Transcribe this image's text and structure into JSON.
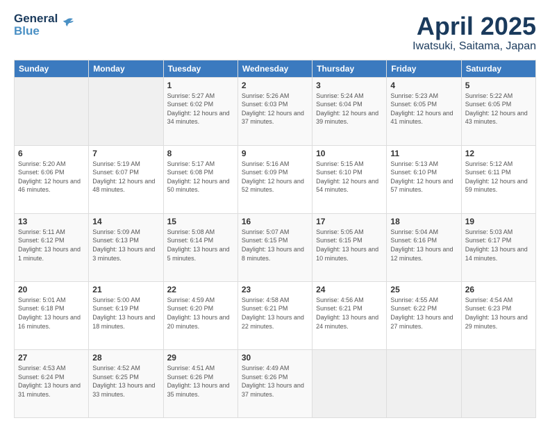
{
  "app": {
    "logo_line1": "General",
    "logo_line2": "Blue"
  },
  "header": {
    "title": "April 2025",
    "subtitle": "Iwatsuki, Saitama, Japan"
  },
  "weekdays": [
    "Sunday",
    "Monday",
    "Tuesday",
    "Wednesday",
    "Thursday",
    "Friday",
    "Saturday"
  ],
  "weeks": [
    [
      {
        "num": "",
        "info": ""
      },
      {
        "num": "",
        "info": ""
      },
      {
        "num": "1",
        "info": "Sunrise: 5:27 AM\nSunset: 6:02 PM\nDaylight: 12 hours and 34 minutes."
      },
      {
        "num": "2",
        "info": "Sunrise: 5:26 AM\nSunset: 6:03 PM\nDaylight: 12 hours and 37 minutes."
      },
      {
        "num": "3",
        "info": "Sunrise: 5:24 AM\nSunset: 6:04 PM\nDaylight: 12 hours and 39 minutes."
      },
      {
        "num": "4",
        "info": "Sunrise: 5:23 AM\nSunset: 6:05 PM\nDaylight: 12 hours and 41 minutes."
      },
      {
        "num": "5",
        "info": "Sunrise: 5:22 AM\nSunset: 6:05 PM\nDaylight: 12 hours and 43 minutes."
      }
    ],
    [
      {
        "num": "6",
        "info": "Sunrise: 5:20 AM\nSunset: 6:06 PM\nDaylight: 12 hours and 46 minutes."
      },
      {
        "num": "7",
        "info": "Sunrise: 5:19 AM\nSunset: 6:07 PM\nDaylight: 12 hours and 48 minutes."
      },
      {
        "num": "8",
        "info": "Sunrise: 5:17 AM\nSunset: 6:08 PM\nDaylight: 12 hours and 50 minutes."
      },
      {
        "num": "9",
        "info": "Sunrise: 5:16 AM\nSunset: 6:09 PM\nDaylight: 12 hours and 52 minutes."
      },
      {
        "num": "10",
        "info": "Sunrise: 5:15 AM\nSunset: 6:10 PM\nDaylight: 12 hours and 54 minutes."
      },
      {
        "num": "11",
        "info": "Sunrise: 5:13 AM\nSunset: 6:10 PM\nDaylight: 12 hours and 57 minutes."
      },
      {
        "num": "12",
        "info": "Sunrise: 5:12 AM\nSunset: 6:11 PM\nDaylight: 12 hours and 59 minutes."
      }
    ],
    [
      {
        "num": "13",
        "info": "Sunrise: 5:11 AM\nSunset: 6:12 PM\nDaylight: 13 hours and 1 minute."
      },
      {
        "num": "14",
        "info": "Sunrise: 5:09 AM\nSunset: 6:13 PM\nDaylight: 13 hours and 3 minutes."
      },
      {
        "num": "15",
        "info": "Sunrise: 5:08 AM\nSunset: 6:14 PM\nDaylight: 13 hours and 5 minutes."
      },
      {
        "num": "16",
        "info": "Sunrise: 5:07 AM\nSunset: 6:15 PM\nDaylight: 13 hours and 8 minutes."
      },
      {
        "num": "17",
        "info": "Sunrise: 5:05 AM\nSunset: 6:15 PM\nDaylight: 13 hours and 10 minutes."
      },
      {
        "num": "18",
        "info": "Sunrise: 5:04 AM\nSunset: 6:16 PM\nDaylight: 13 hours and 12 minutes."
      },
      {
        "num": "19",
        "info": "Sunrise: 5:03 AM\nSunset: 6:17 PM\nDaylight: 13 hours and 14 minutes."
      }
    ],
    [
      {
        "num": "20",
        "info": "Sunrise: 5:01 AM\nSunset: 6:18 PM\nDaylight: 13 hours and 16 minutes."
      },
      {
        "num": "21",
        "info": "Sunrise: 5:00 AM\nSunset: 6:19 PM\nDaylight: 13 hours and 18 minutes."
      },
      {
        "num": "22",
        "info": "Sunrise: 4:59 AM\nSunset: 6:20 PM\nDaylight: 13 hours and 20 minutes."
      },
      {
        "num": "23",
        "info": "Sunrise: 4:58 AM\nSunset: 6:21 PM\nDaylight: 13 hours and 22 minutes."
      },
      {
        "num": "24",
        "info": "Sunrise: 4:56 AM\nSunset: 6:21 PM\nDaylight: 13 hours and 24 minutes."
      },
      {
        "num": "25",
        "info": "Sunrise: 4:55 AM\nSunset: 6:22 PM\nDaylight: 13 hours and 27 minutes."
      },
      {
        "num": "26",
        "info": "Sunrise: 4:54 AM\nSunset: 6:23 PM\nDaylight: 13 hours and 29 minutes."
      }
    ],
    [
      {
        "num": "27",
        "info": "Sunrise: 4:53 AM\nSunset: 6:24 PM\nDaylight: 13 hours and 31 minutes."
      },
      {
        "num": "28",
        "info": "Sunrise: 4:52 AM\nSunset: 6:25 PM\nDaylight: 13 hours and 33 minutes."
      },
      {
        "num": "29",
        "info": "Sunrise: 4:51 AM\nSunset: 6:26 PM\nDaylight: 13 hours and 35 minutes."
      },
      {
        "num": "30",
        "info": "Sunrise: 4:49 AM\nSunset: 6:26 PM\nDaylight: 13 hours and 37 minutes."
      },
      {
        "num": "",
        "info": ""
      },
      {
        "num": "",
        "info": ""
      },
      {
        "num": "",
        "info": ""
      }
    ]
  ]
}
